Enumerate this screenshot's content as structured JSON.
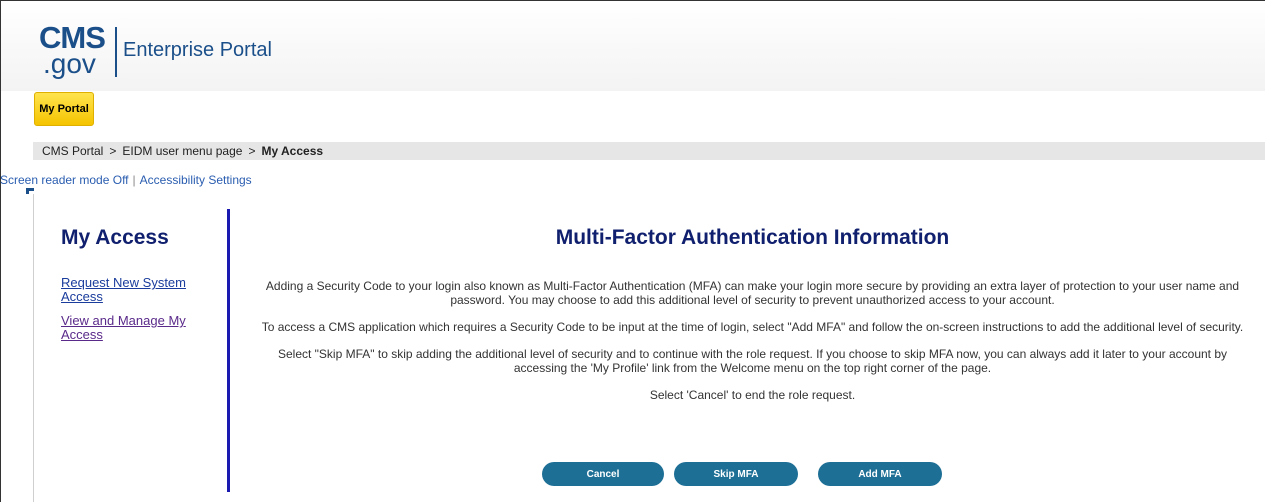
{
  "header": {
    "logo_cms": "CMS",
    "logo_gov": ".gov",
    "logo_portal": "Enterprise Portal",
    "portal_tab": "My Portal"
  },
  "breadcrumb": {
    "items": [
      "CMS Portal",
      "EIDM user menu page"
    ],
    "separator": ">",
    "current": "My Access"
  },
  "accessibility": {
    "screen_reader": "Screen reader mode Off",
    "divider": "|",
    "settings": "Accessibility Settings"
  },
  "sidebar": {
    "title": "My Access",
    "links": [
      {
        "label": "Request New System Access"
      },
      {
        "label": "View and Manage My Access"
      }
    ]
  },
  "main": {
    "title": "Multi-Factor Authentication Information",
    "paragraphs": [
      "Adding a Security Code to your login also known as Multi-Factor Authentication (MFA) can make your login more secure by providing an extra layer of protection to your user name and password. You may choose to add this additional level of security to prevent unauthorized access to your account.",
      "To access a CMS application which requires a Security Code to be input at the time of login, select \"Add MFA\" and follow the on-screen instructions to add the additional level of security.",
      "Select \"Skip MFA\" to skip adding the additional level of security and to continue with the role request. If you choose to skip MFA now, you can always add it later to your account by accessing the 'My Profile' link from the Welcome menu on the top right corner of the page.",
      "Select 'Cancel' to end the role request."
    ]
  },
  "buttons": {
    "cancel": "Cancel",
    "skip": "Skip MFA",
    "add": "Add MFA"
  },
  "colors": {
    "brand": "#1b4f8a",
    "heading": "#10206e",
    "button": "#1d6f96",
    "tab": "#f5c400",
    "divider": "#1a1ab0"
  }
}
